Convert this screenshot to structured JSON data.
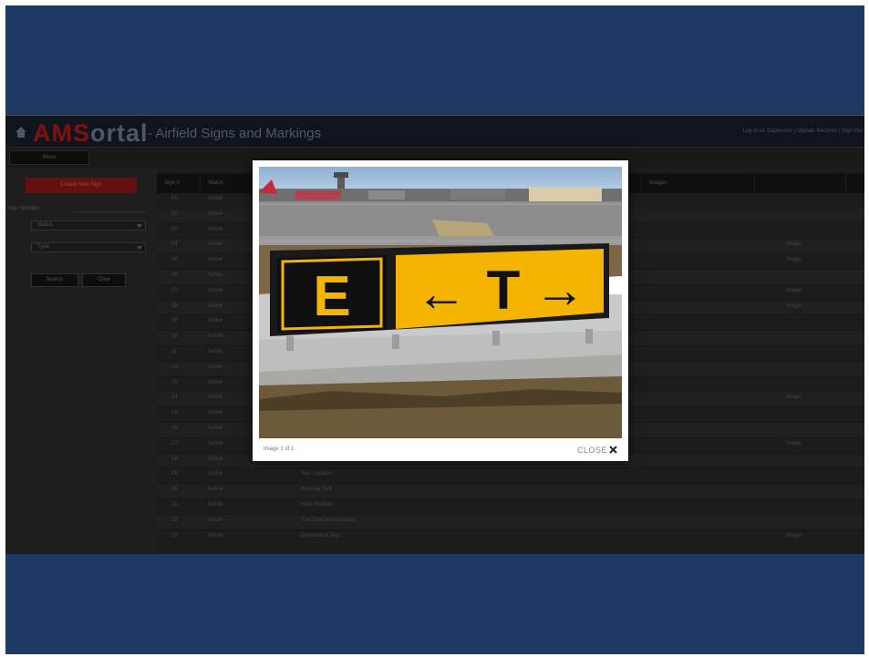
{
  "app": {
    "logo_part1": "AMS",
    "logo_part2": "ortal",
    "title": "- Airfield Signs and Markings",
    "user_info": "Log In as Supervisor | Update Records | Sign Out",
    "menu_button": "Menu"
  },
  "sidebar": {
    "primary_button": "Create New Sign",
    "filter_label": "Sign Number:",
    "select_status": "Status",
    "select_type": "Type",
    "search_button": "Search",
    "clear_button": "Clear"
  },
  "table": {
    "headers": [
      "Sign #",
      "Status",
      "",
      "Images",
      ""
    ],
    "rows": [
      {
        "num": "01",
        "status": "Active",
        "desc": "",
        "images": ""
      },
      {
        "num": "02",
        "status": "Active",
        "desc": "",
        "images": ""
      },
      {
        "num": "03",
        "status": "Active",
        "desc": "",
        "images": ""
      },
      {
        "num": "04",
        "status": "Active",
        "desc": "",
        "images": "Image"
      },
      {
        "num": "05",
        "status": "Active",
        "desc": "",
        "images": "Image"
      },
      {
        "num": "06",
        "status": "Active",
        "desc": "",
        "images": ""
      },
      {
        "num": "07",
        "status": "Active",
        "desc": "",
        "images": "Image"
      },
      {
        "num": "08",
        "status": "Active",
        "desc": "",
        "images": "Image"
      },
      {
        "num": "09",
        "status": "Active",
        "desc": "",
        "images": ""
      },
      {
        "num": "10",
        "status": "Active",
        "desc": "",
        "images": ""
      },
      {
        "num": "11",
        "status": "Active",
        "desc": "",
        "images": ""
      },
      {
        "num": "12",
        "status": "Active",
        "desc": "",
        "images": ""
      },
      {
        "num": "13",
        "status": "Active",
        "desc": "",
        "images": ""
      },
      {
        "num": "14",
        "status": "Active",
        "desc": "",
        "images": "Image"
      },
      {
        "num": "15",
        "status": "Active",
        "desc": "",
        "images": ""
      },
      {
        "num": "16",
        "status": "Active",
        "desc": "",
        "images": ""
      },
      {
        "num": "17",
        "status": "Active",
        "desc": "",
        "images": "Image"
      },
      {
        "num": "18",
        "status": "Active",
        "desc": "",
        "images": ""
      },
      {
        "num": "19",
        "status": "Active",
        "desc": "Taxi Location",
        "images": ""
      },
      {
        "num": "20",
        "status": "Active",
        "desc": "Runway Exit",
        "images": ""
      },
      {
        "num": "21",
        "status": "Active",
        "desc": "Hold Position",
        "images": ""
      },
      {
        "num": "22",
        "status": "Active",
        "desc": "Taxi Direction/Location",
        "images": ""
      },
      {
        "num": "23",
        "status": "Active",
        "desc": "Destination Sign",
        "images": "Image"
      }
    ]
  },
  "modal": {
    "caption": "Image 1 of 1",
    "close_label": "CLOSE",
    "sign": {
      "location_letter": "E",
      "left_arrow": "←",
      "direction_letter": "T",
      "right_arrow": "→"
    },
    "colors": {
      "sky": "#a9c3df",
      "sign_yellow": "#f4b400",
      "sign_black": "#111111"
    }
  }
}
